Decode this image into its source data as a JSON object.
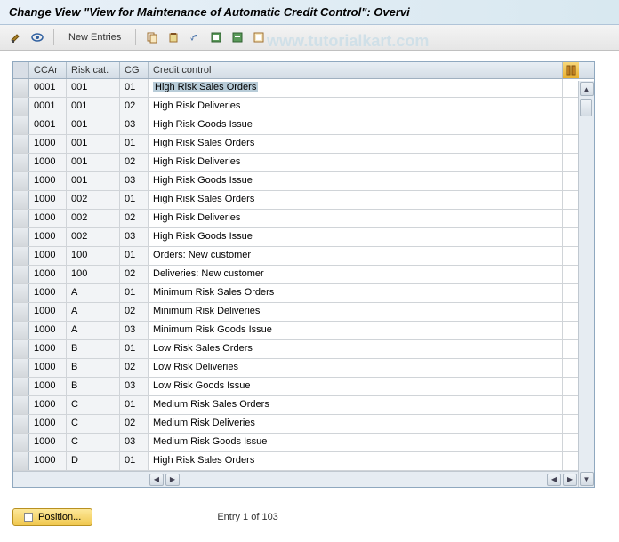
{
  "title": "Change View \"View for Maintenance of Automatic Credit Control\": Overvi",
  "watermark": "www.tutorialkart.com",
  "toolbar": {
    "new_entries": "New Entries"
  },
  "columns": {
    "ccar": "CCAr",
    "risk": "Risk cat.",
    "cg": "CG",
    "desc": "Credit control"
  },
  "rows": [
    {
      "ccar": "0001",
      "risk": "001",
      "cg": "01",
      "desc": "High Risk Sales Orders",
      "hl": true
    },
    {
      "ccar": "0001",
      "risk": "001",
      "cg": "02",
      "desc": "High Risk Deliveries"
    },
    {
      "ccar": "0001",
      "risk": "001",
      "cg": "03",
      "desc": "High Risk Goods Issue"
    },
    {
      "ccar": "1000",
      "risk": "001",
      "cg": "01",
      "desc": "High Risk Sales Orders"
    },
    {
      "ccar": "1000",
      "risk": "001",
      "cg": "02",
      "desc": "High Risk Deliveries"
    },
    {
      "ccar": "1000",
      "risk": "001",
      "cg": "03",
      "desc": "High Risk Goods Issue"
    },
    {
      "ccar": "1000",
      "risk": "002",
      "cg": "01",
      "desc": "High Risk Sales Orders"
    },
    {
      "ccar": "1000",
      "risk": "002",
      "cg": "02",
      "desc": "High Risk Deliveries"
    },
    {
      "ccar": "1000",
      "risk": "002",
      "cg": "03",
      "desc": "High Risk Goods Issue"
    },
    {
      "ccar": "1000",
      "risk": "100",
      "cg": "01",
      "desc": "Orders: New customer"
    },
    {
      "ccar": "1000",
      "risk": "100",
      "cg": "02",
      "desc": "Deliveries: New customer"
    },
    {
      "ccar": "1000",
      "risk": "A",
      "cg": "01",
      "desc": "Minimum Risk Sales Orders"
    },
    {
      "ccar": "1000",
      "risk": "A",
      "cg": "02",
      "desc": "Minimum Risk Deliveries"
    },
    {
      "ccar": "1000",
      "risk": "A",
      "cg": "03",
      "desc": "Minimum Risk Goods Issue"
    },
    {
      "ccar": "1000",
      "risk": "B",
      "cg": "01",
      "desc": "Low Risk Sales Orders"
    },
    {
      "ccar": "1000",
      "risk": "B",
      "cg": "02",
      "desc": "Low Risk Deliveries"
    },
    {
      "ccar": "1000",
      "risk": "B",
      "cg": "03",
      "desc": "Low Risk Goods Issue"
    },
    {
      "ccar": "1000",
      "risk": "C",
      "cg": "01",
      "desc": "Medium Risk Sales Orders"
    },
    {
      "ccar": "1000",
      "risk": "C",
      "cg": "02",
      "desc": "Medium Risk Deliveries"
    },
    {
      "ccar": "1000",
      "risk": "C",
      "cg": "03",
      "desc": "Medium Risk Goods Issue"
    },
    {
      "ccar": "1000",
      "risk": "D",
      "cg": "01",
      "desc": "High Risk Sales Orders"
    }
  ],
  "footer": {
    "position": "Position...",
    "entry": "Entry 1 of 103"
  }
}
